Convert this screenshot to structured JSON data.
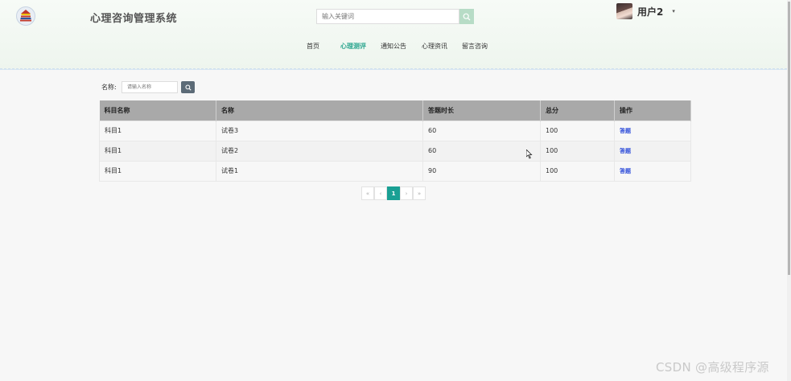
{
  "header": {
    "app_title": "心理咨询管理系统",
    "search_placeholder": "输入关键词",
    "user_name": "用户2",
    "user_caret": "▾"
  },
  "nav": {
    "items": [
      {
        "label": "首页",
        "active": false
      },
      {
        "label": "心理测评",
        "active": true
      },
      {
        "label": "通知公告",
        "active": false
      },
      {
        "label": "心理资讯",
        "active": false
      },
      {
        "label": "留言咨询",
        "active": false
      }
    ]
  },
  "filter": {
    "label": "名称:",
    "placeholder": "请输入名称"
  },
  "table": {
    "headers": [
      "科目名称",
      "名称",
      "答题时长",
      "总分",
      "操作"
    ],
    "rows": [
      [
        "科目1",
        "试卷3",
        "60",
        "100",
        "答题"
      ],
      [
        "科目1",
        "试卷2",
        "60",
        "100",
        "答题"
      ],
      [
        "科目1",
        "试卷1",
        "90",
        "100",
        "答题"
      ]
    ]
  },
  "pagination": {
    "first": "«",
    "prev": "‹",
    "current": "1",
    "next": "›",
    "last": "»"
  },
  "watermark": "CSDN @高级程序源",
  "colors": {
    "accent": "#1aa094",
    "active_nav": "#2aa58e",
    "table_header": "#a9a9a9",
    "link": "#2c4bd9"
  }
}
